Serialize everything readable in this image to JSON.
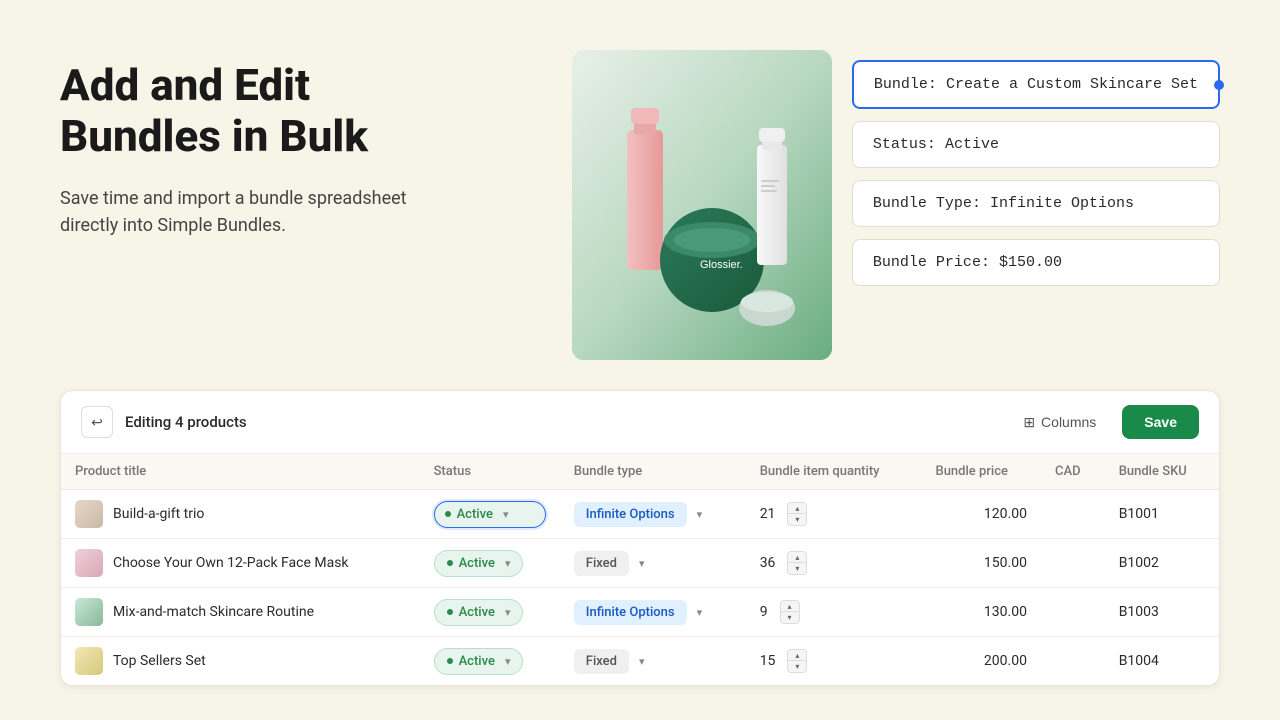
{
  "page": {
    "background": "#f7f5e8"
  },
  "hero": {
    "title_line1": "Add and Edit",
    "title_line2": "Bundles in Bulk",
    "subtitle": "Save time and import a bundle spreadsheet directly into Simple Bundles."
  },
  "info_cards": {
    "bundle_name_label": "Bundle:",
    "bundle_name_value": "Create a Custom Skincare Set",
    "status_label": "Status:",
    "status_value": "Active",
    "bundle_type_label": "Bundle Type:",
    "bundle_type_value": "Infinite Options",
    "bundle_price_label": "Bundle Price:",
    "bundle_price_value": "$150.00"
  },
  "toolbar": {
    "editing_label": "Editing 4 products",
    "columns_label": "Columns",
    "save_label": "Save"
  },
  "table": {
    "headers": {
      "product_title": "Product title",
      "status": "Status",
      "bundle_type": "Bundle type",
      "bundle_item_qty": "Bundle item quantity",
      "bundle_price": "Bundle price",
      "currency": "CAD",
      "bundle_sku": "Bundle SKU"
    },
    "rows": [
      {
        "id": 1,
        "product_title": "Build-a-gift trio",
        "thumb_color": "tan",
        "status": "Active",
        "status_focused": true,
        "bundle_type": "Infinite Options",
        "bundle_item_quantity": 21,
        "bundle_price": "120.00",
        "bundle_sku": "B1001"
      },
      {
        "id": 2,
        "product_title": "Choose Your Own 12-Pack Face Mask",
        "thumb_color": "pink",
        "status": "Active",
        "status_focused": false,
        "bundle_type": "Fixed",
        "bundle_item_quantity": 36,
        "bundle_price": "150.00",
        "bundle_sku": "B1002"
      },
      {
        "id": 3,
        "product_title": "Mix-and-match Skincare Routine",
        "thumb_color": "green",
        "status": "Active",
        "status_focused": false,
        "bundle_type": "Infinite Options",
        "bundle_item_quantity": 9,
        "bundle_price": "130.00",
        "bundle_sku": "B1003"
      },
      {
        "id": 4,
        "product_title": "Top Sellers Set",
        "thumb_color": "yellow",
        "status": "Active",
        "status_focused": false,
        "bundle_type": "Fixed",
        "bundle_item_quantity": 15,
        "bundle_price": "200.00",
        "bundle_sku": "B1004"
      }
    ]
  },
  "icons": {
    "back": "↩",
    "columns": "⊞",
    "chevron_down": "▾",
    "chevron_up": "▴"
  }
}
